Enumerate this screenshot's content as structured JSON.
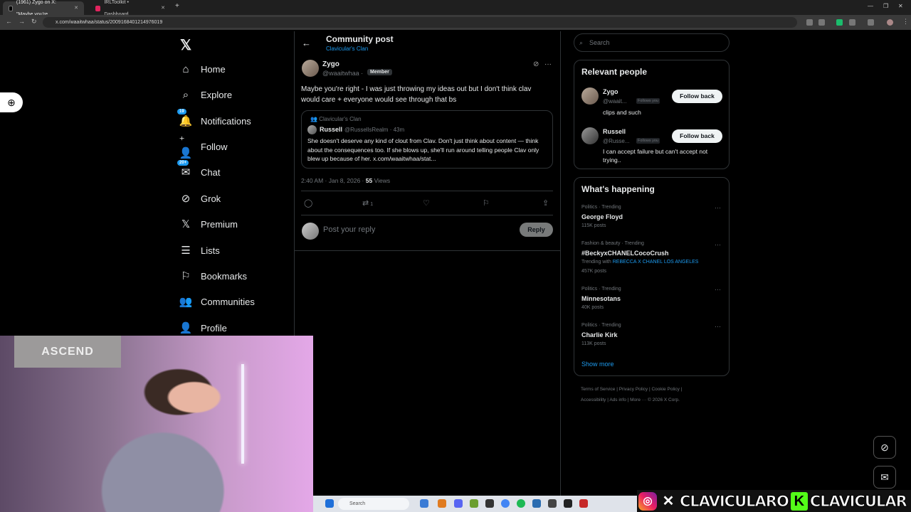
{
  "browser": {
    "tabs": [
      {
        "title": "(1961) Zygo on X: \"Maybe you're",
        "active": true,
        "favicon_color": "#000000"
      },
      {
        "title": "IRLToolkit • Dashboard",
        "active": false,
        "favicon_color": "#e0245e"
      }
    ],
    "url": "x.com/waaitwhaa/status/2009168401214976019"
  },
  "nav": {
    "items": [
      {
        "label": "Home",
        "icon": "home-icon",
        "glyph": "⌂"
      },
      {
        "label": "Explore",
        "icon": "search-icon",
        "glyph": "⌕"
      },
      {
        "label": "Notifications",
        "icon": "bell-icon",
        "glyph": "🔔",
        "badge": "19"
      },
      {
        "label": "Follow",
        "icon": "person-add-icon",
        "glyph": "⁺👤"
      },
      {
        "label": "Chat",
        "icon": "mail-icon",
        "glyph": "✉",
        "badge": "20+"
      },
      {
        "label": "Grok",
        "icon": "grok-icon",
        "glyph": "⊘"
      },
      {
        "label": "Premium",
        "icon": "x-premium-icon",
        "glyph": "𝕏"
      },
      {
        "label": "Lists",
        "icon": "list-icon",
        "glyph": "☰"
      },
      {
        "label": "Bookmarks",
        "icon": "bookmark-icon",
        "glyph": "⚐"
      },
      {
        "label": "Communities",
        "icon": "communities-icon",
        "glyph": "👥"
      },
      {
        "label": "Profile",
        "icon": "profile-icon",
        "glyph": "👤"
      }
    ]
  },
  "header": {
    "title": "Community post",
    "community": "Clavicular's Clan"
  },
  "post": {
    "name": "Zygo",
    "handle": "@waaitwhaa",
    "badge": "Member",
    "text": "Maybe you're right - I was just throwing my ideas out but I don't think clav would care + everyone would see through that bs",
    "quote": {
      "community": "Clavicular's Clan",
      "name": "Russell",
      "handle_time": "@RussellsRealm · 43m",
      "text": "She doesn't deserve any kind of clout from Clav. Don't just think about content — think about the consequences too. If she blows up, she'll run around telling people Clav only blew up because of her. x.com/waaitwhaa/stat..."
    },
    "time": "2:40 AM · Jan 8, 2026 · ",
    "views_count": "55",
    "views_label": " Views",
    "retweet_count": "1"
  },
  "reply": {
    "placeholder": "Post your reply",
    "button": "Reply"
  },
  "search": {
    "placeholder": "Search"
  },
  "relevant_people": {
    "title": "Relevant people",
    "people": [
      {
        "name": "Zygo",
        "handle": "@waait...",
        "follows_you": "Follows you",
        "bio": "clips and such",
        "button": "Follow back"
      },
      {
        "name": "Russell",
        "handle": "@Russe...",
        "follows_you": "Follows you",
        "bio": "I can accept failure but can't accept not trying..",
        "button": "Follow back"
      }
    ]
  },
  "happening": {
    "title": "What's happening",
    "trends": [
      {
        "category": "Politics · Trending",
        "name": "George Floyd",
        "count": "115K posts"
      },
      {
        "category": "Fashion & beauty · Trending",
        "name": "#BeckyxCHANELCocoCrush",
        "with_prefix": "Trending with ",
        "with_link": "REBECCA X CHANEL LOS ANGELES",
        "count": "457K posts"
      },
      {
        "category": "Politics · Trending",
        "name": "Minnesotans",
        "count": "40K posts"
      },
      {
        "category": "Politics · Trending",
        "name": "Charlie Kirk",
        "count": "113K posts"
      }
    ],
    "show_more": "Show more"
  },
  "footer": {
    "line1": "Terms of Service  |  Privacy Policy  |  Cookie Policy  |",
    "line2": "Accessibility  |  Ads info  |  More ···  © 2026 X Corp."
  },
  "stream": {
    "cam_banner": "ASCEND",
    "taskbar_search": "Search",
    "watermark_text1": "CLAVICULARO",
    "watermark_k": "K",
    "watermark_text2": "CLAVICULAR"
  },
  "colors": {
    "accent": "#1d9bf0",
    "background": "#000000",
    "border": "#2f3336",
    "muted": "#71767b"
  }
}
